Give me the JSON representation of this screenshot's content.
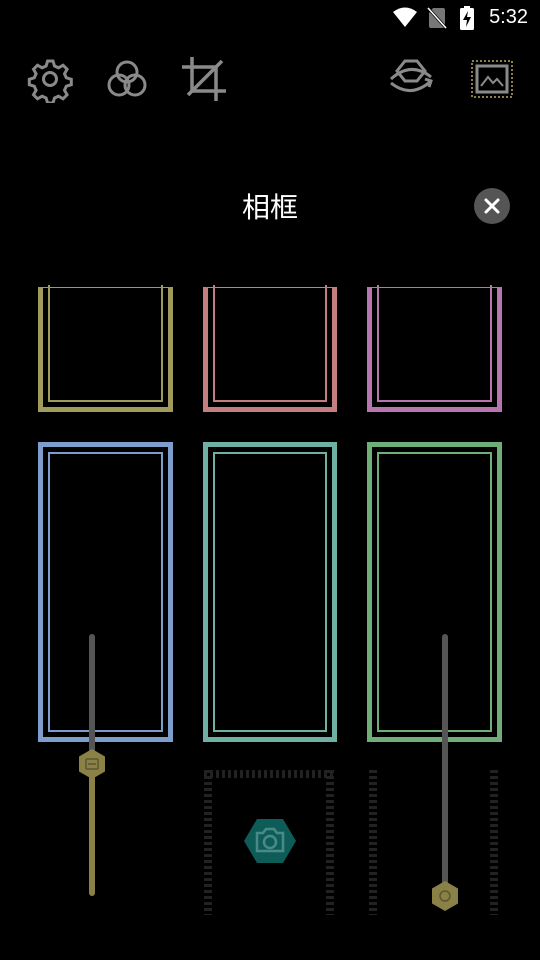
{
  "status_bar": {
    "time": "5:32",
    "icons": [
      "wifi-icon",
      "no-sim-icon",
      "battery-charging-icon"
    ]
  },
  "toolbar": {
    "left_icons": [
      "gear-icon",
      "filters-icon",
      "crop-icon"
    ],
    "right_icons": [
      "rotate-icon",
      "frame-icon"
    ]
  },
  "dialog": {
    "title": "相框"
  },
  "frames": {
    "row1": [
      {
        "color": "#a09a5c"
      },
      {
        "color": "#c47e80"
      },
      {
        "color": "#b876b0"
      }
    ],
    "row2": [
      {
        "color": "#7d9ecc"
      },
      {
        "color": "#6fb0a4"
      },
      {
        "color": "#6fae78"
      }
    ]
  },
  "sliders": {
    "left": {
      "color_top": "#555555",
      "color_bottom": "#8a8146",
      "level": 0.48
    },
    "right": {
      "color": "#555555",
      "level": 0.0
    }
  },
  "camera_button": {
    "icon": "camera-icon",
    "color": "#0e5c58"
  }
}
